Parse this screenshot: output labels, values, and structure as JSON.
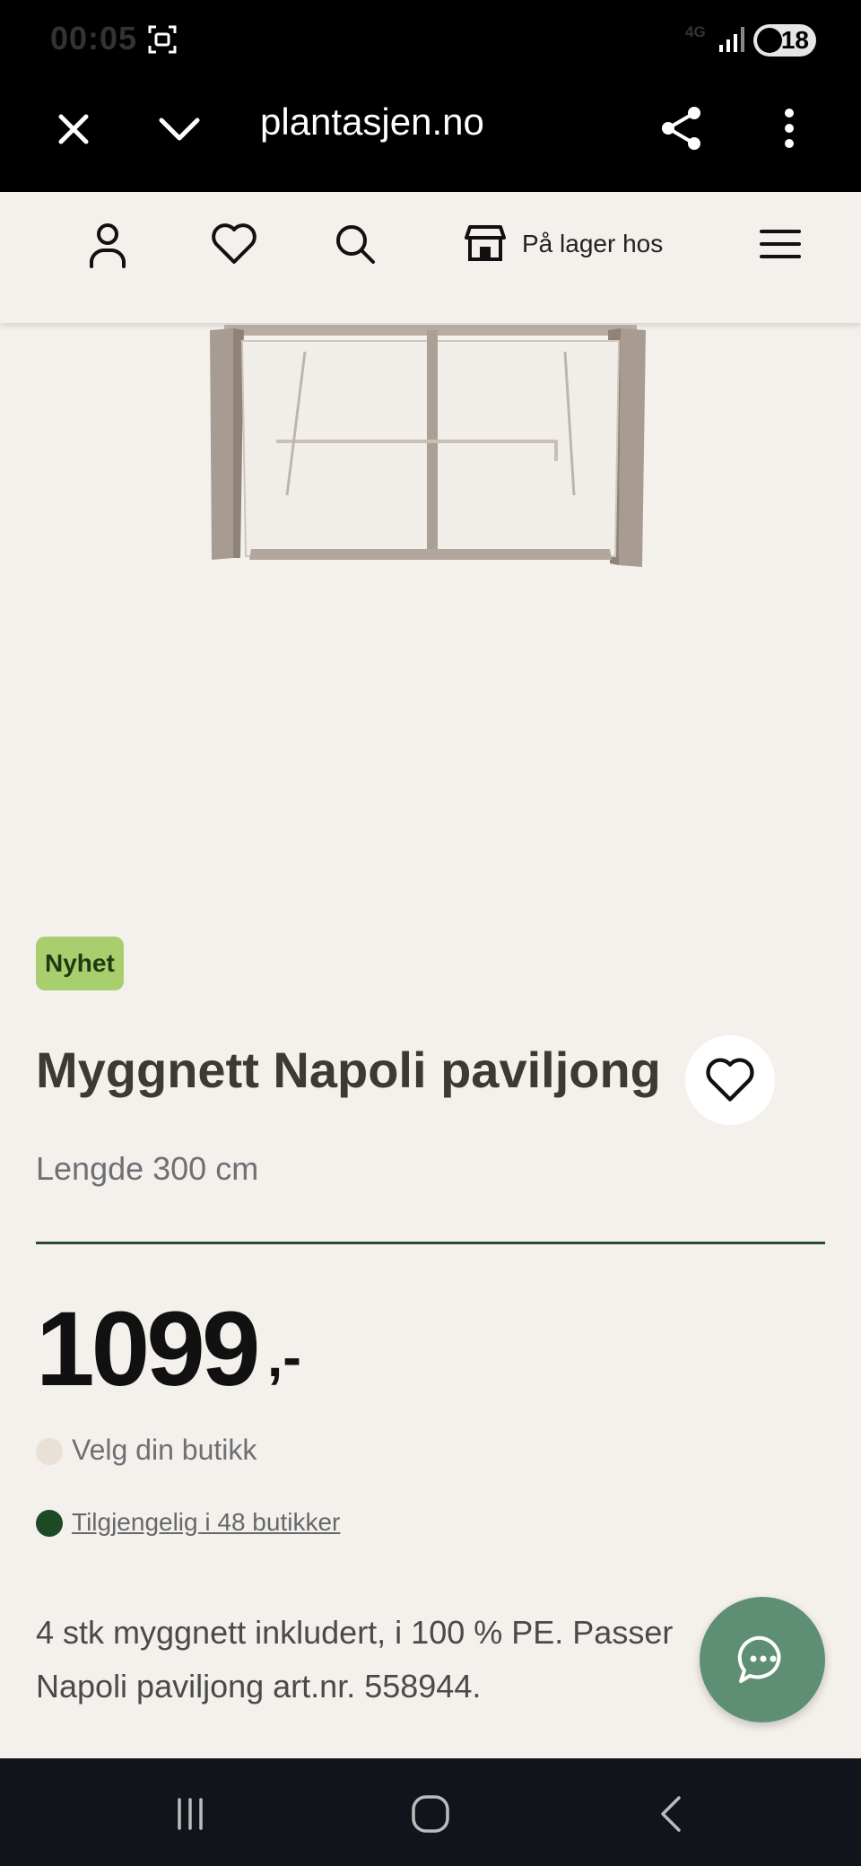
{
  "status_bar": {
    "time": "00:05",
    "network": "4G",
    "battery": "18"
  },
  "browser": {
    "url": "plantasjen.no"
  },
  "header": {
    "store_label": "På lager hos"
  },
  "product": {
    "badge": "Nyhet",
    "title": "Myggnett Napoli paviljong",
    "subtitle": "Lengde 300 cm",
    "price": "1099",
    "price_suffix": ",-",
    "store_select": "Velg din butikk",
    "availability": "Tilgjengelig i 48 butikker",
    "description": "4 stk myggnett inkludert, i 100 % PE. Passer Napoli paviljong art.nr. 558944."
  },
  "colors": {
    "badge": "#a8cf6d",
    "divider": "#2c4a33",
    "available_dot": "#1d4a24",
    "chat_button": "#5e8f75"
  }
}
